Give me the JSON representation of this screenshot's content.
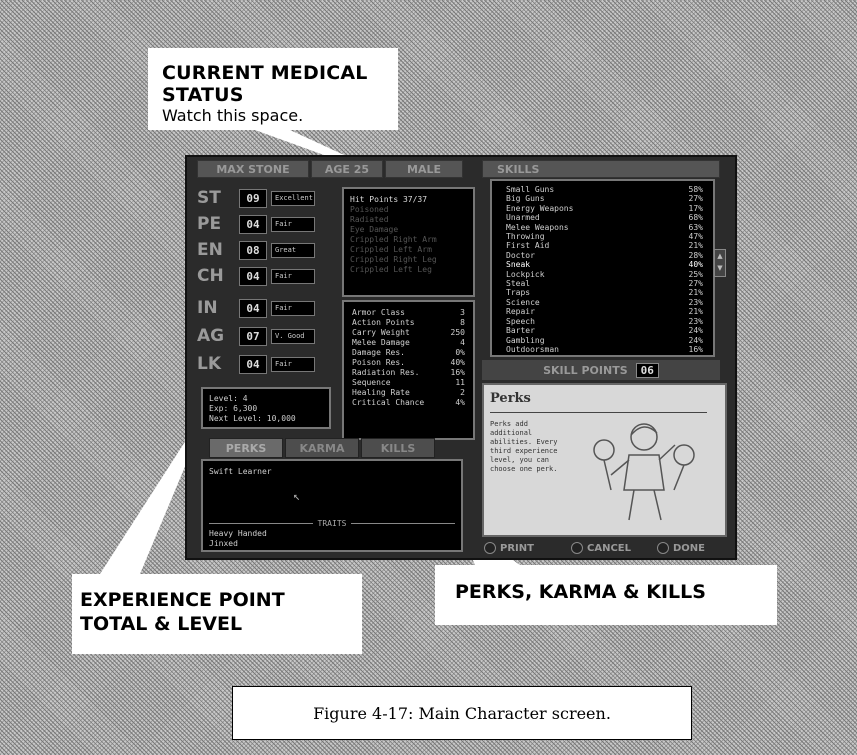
{
  "callouts": {
    "medical_title": "CURRENT MEDICAL STATUS",
    "medical_sub": "Watch this space.",
    "xp_line1": "EXPERIENCE POINT",
    "xp_line2": "TOTAL & LEVEL",
    "perks_karma_kills": "PERKS, KARMA & KILLS"
  },
  "caption": "Figure 4-17: Main Character screen.",
  "header": {
    "name": "MAX STONE",
    "age": "AGE 25",
    "sex": "MALE"
  },
  "stats": [
    {
      "abbr": "ST",
      "value": "09",
      "desc": "Excellent"
    },
    {
      "abbr": "PE",
      "value": "04",
      "desc": "Fair"
    },
    {
      "abbr": "EN",
      "value": "08",
      "desc": "Great"
    },
    {
      "abbr": "CH",
      "value": "04",
      "desc": "Fair"
    },
    {
      "abbr": "IN",
      "value": "04",
      "desc": "Fair"
    },
    {
      "abbr": "AG",
      "value": "07",
      "desc": "V. Good"
    },
    {
      "abbr": "LK",
      "value": "04",
      "desc": "Fair"
    }
  ],
  "medical": {
    "hit_points": "Hit Points 37/37",
    "conditions": [
      "Poisoned",
      "Radiated",
      "Eye Damage",
      "Crippled Right Arm",
      "Crippled Left Arm",
      "Crippled Right Leg",
      "Crippled Left Leg"
    ]
  },
  "derived": [
    {
      "label": "Armor Class",
      "value": "3"
    },
    {
      "label": "Action Points",
      "value": "8"
    },
    {
      "label": "Carry Weight",
      "value": "250"
    },
    {
      "label": "Melee Damage",
      "value": "4"
    },
    {
      "label": "Damage Res.",
      "value": "0%"
    },
    {
      "label": "Poison Res.",
      "value": "40%"
    },
    {
      "label": "Radiation Res.",
      "value": "16%"
    },
    {
      "label": "Sequence",
      "value": "11"
    },
    {
      "label": "Healing Rate",
      "value": "2"
    },
    {
      "label": "Critical Chance",
      "value": "4%"
    }
  ],
  "level": {
    "line1": "Level: 4",
    "line2": "Exp: 6,300",
    "line3": "Next Level: 10,000"
  },
  "tabs": [
    "PERKS",
    "KARMA",
    "KILLS"
  ],
  "perks": {
    "entry1": "Swift Learner",
    "title": "TRAITS",
    "trait1": "Heavy Handed",
    "trait2": "Jinxed"
  },
  "skills": {
    "header": "SKILLS",
    "list": [
      {
        "name": "Small Guns",
        "value": "58%"
      },
      {
        "name": "Big Guns",
        "value": "27%"
      },
      {
        "name": "Energy Weapons",
        "value": "17%"
      },
      {
        "name": "Unarmed",
        "value": "68%"
      },
      {
        "name": "Melee Weapons",
        "value": "63%"
      },
      {
        "name": "Throwing",
        "value": "47%"
      },
      {
        "name": "First Aid",
        "value": "21%"
      },
      {
        "name": "Doctor",
        "value": "28%"
      },
      {
        "name": "Sneak",
        "value": "40%"
      },
      {
        "name": "Lockpick",
        "value": "25%"
      },
      {
        "name": "Steal",
        "value": "27%"
      },
      {
        "name": "Traps",
        "value": "21%"
      },
      {
        "name": "Science",
        "value": "23%"
      },
      {
        "name": "Repair",
        "value": "21%"
      },
      {
        "name": "Speech",
        "value": "23%"
      },
      {
        "name": "Barter",
        "value": "24%"
      },
      {
        "name": "Gambling",
        "value": "24%"
      },
      {
        "name": "Outdoorsman",
        "value": "16%"
      }
    ],
    "points_label": "SKILL POINTS",
    "points_value": "06"
  },
  "info_card": {
    "title": "Perks",
    "text": "Perks add additional abilities. Every third experience level, you can choose one perk."
  },
  "buttons": {
    "print": "PRINT",
    "cancel": "CANCEL",
    "done": "DONE"
  }
}
